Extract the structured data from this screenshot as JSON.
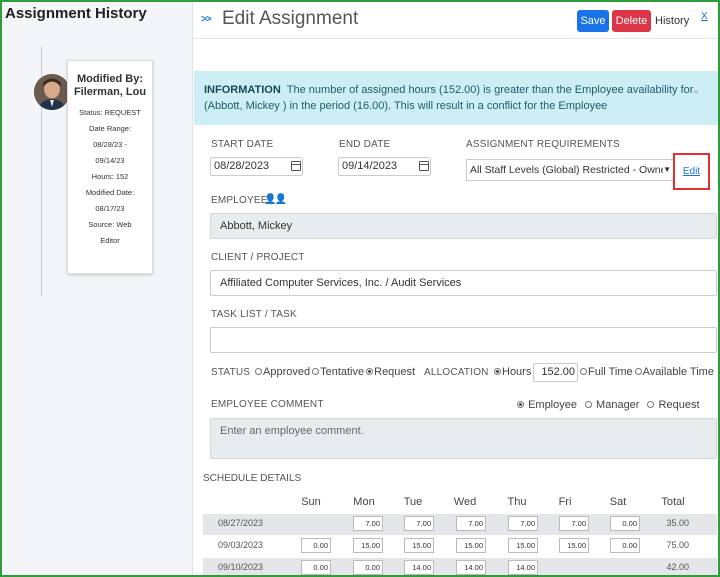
{
  "history": {
    "title": "Assignment History",
    "modified_by_label": "Modified By:",
    "modified_by_name": "Filerman, Lou",
    "status": "Status: REQUEST",
    "date_range_label": "Date Range:",
    "date_range_start": "08/28/23 -",
    "date_range_end": "09/14/23",
    "hours": "Hours: 152",
    "modified_date_label": "Modified Date:",
    "modified_date": "08/17/23",
    "source": "Source: Web",
    "source_cont": "Editor"
  },
  "header": {
    "toggle": ">>",
    "title": "Edit Assignment",
    "save": "Save",
    "delete": "Delete",
    "history": "History",
    "close": "X"
  },
  "alert": {
    "heading": "INFORMATION",
    "message": "The number of assigned hours (152.00) is greater than the Employee availability for (Abbott, Mickey ) in the period (16.00). This will result in a conflict for the Employee",
    "close": "×"
  },
  "form": {
    "start_date_label": "START DATE",
    "start_date": "08/28/2023",
    "end_date_label": "END DATE",
    "end_date": "09/14/2023",
    "requirements_label": "ASSIGNMENT REQUIREMENTS",
    "requirements_value": "All Staff Levels (Global) Restricted - Owner",
    "edit": "Edit",
    "employee_label": "EMPLOYEE",
    "employee": "Abbott, Mickey",
    "client_label": "CLIENT / PROJECT",
    "client": "Affiliated Computer Services, Inc. / Audit Services",
    "task_label": "TASK LIST / TASK",
    "task": "",
    "status_label": "STATUS",
    "status_options": [
      "Approved",
      "Tentative",
      "Request"
    ],
    "status_selected": "Request",
    "allocation_label": "ALLOCATION",
    "allocation_hours_label": "Hours",
    "allocation_hours": "152.00",
    "allocation_full": "Full Time",
    "allocation_available": "Available Time",
    "comment_label": "EMPLOYEE COMMENT",
    "comment_options": [
      "Employee",
      "Manager",
      "Request"
    ],
    "comment_placeholder": "Enter an employee comment."
  },
  "schedule": {
    "title": "SCHEDULE DETAILS",
    "columns": [
      "Sun",
      "Mon",
      "Tue",
      "Wed",
      "Thu",
      "Fri",
      "Sat",
      "Total"
    ],
    "rows": [
      {
        "date": "08/27/2023",
        "values": [
          "",
          "7.00",
          "7.00",
          "7.00",
          "7.00",
          "7.00",
          "0.00"
        ],
        "total": "35.00"
      },
      {
        "date": "09/03/2023",
        "values": [
          "0.00",
          "15.00",
          "15.00",
          "15.00",
          "15.00",
          "15.00",
          "0.00"
        ],
        "total": "75.00"
      },
      {
        "date": "09/10/2023",
        "values": [
          "0.00",
          "0.00",
          "14.00",
          "14.00",
          "14.00",
          "",
          ""
        ],
        "total": "42.00"
      }
    ]
  },
  "colors": {
    "primary": "#1a73e8",
    "danger": "#dc3545",
    "info_bg": "#cdeef4",
    "frame": "#2e9e3a",
    "highlight": "#e03030"
  }
}
